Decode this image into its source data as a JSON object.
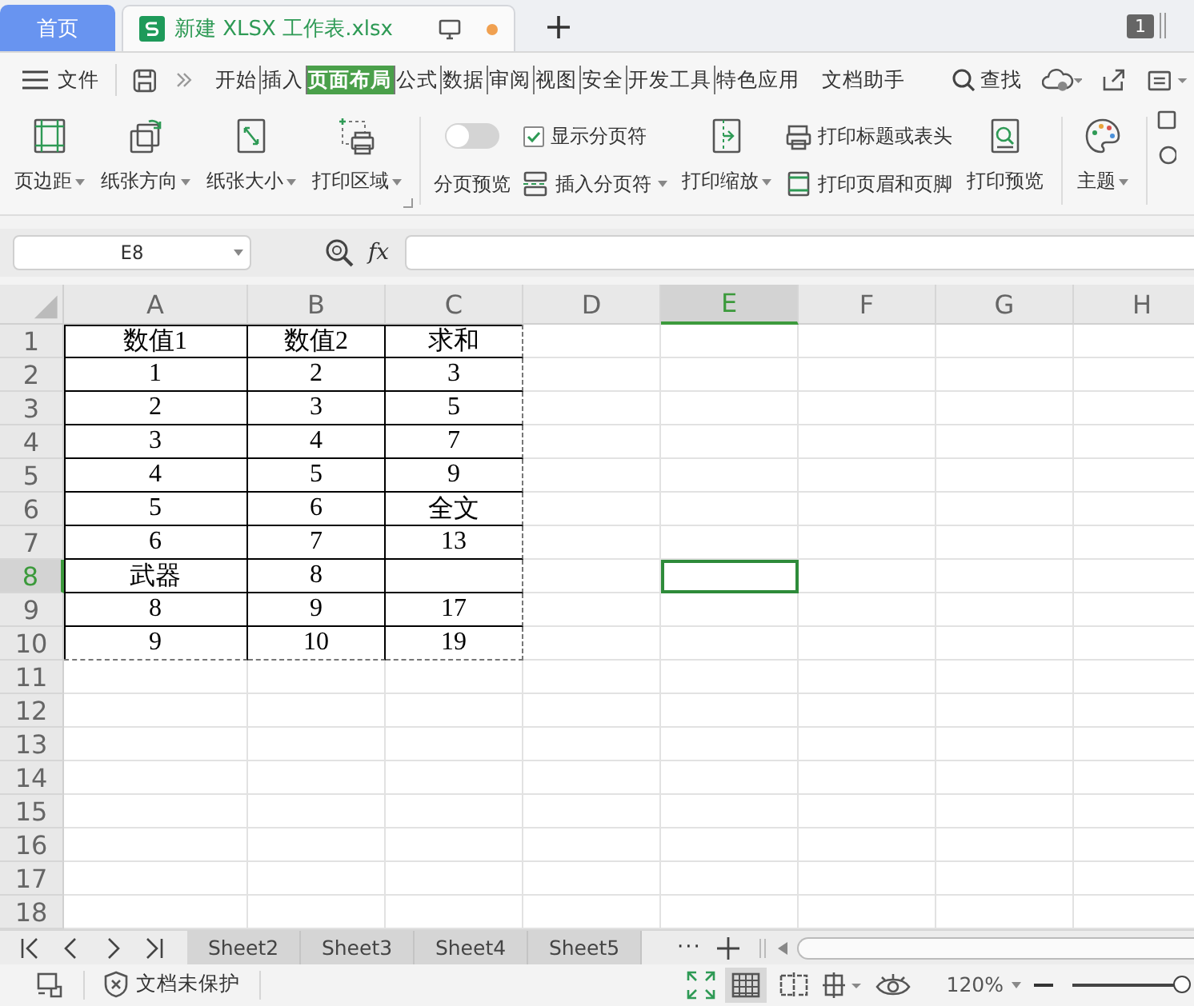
{
  "tab_bar": {
    "tabs": [
      {
        "kind": "home",
        "label": "首页",
        "selected": false
      },
      {
        "kind": "document",
        "label": "新建 XLSX 工作表.xlsx",
        "selected": true,
        "modified": true
      }
    ],
    "window_count": "1"
  },
  "menu_bar": {
    "file": "文件",
    "tabs": [
      {
        "label": "开始",
        "selected": false
      },
      {
        "label": "插入",
        "selected": false
      },
      {
        "label": "页面布局",
        "selected": true
      },
      {
        "label": "公式",
        "selected": false
      },
      {
        "label": "数据",
        "selected": false
      },
      {
        "label": "审阅",
        "selected": false
      },
      {
        "label": "视图",
        "selected": false
      },
      {
        "label": "安全",
        "selected": false
      },
      {
        "label": "开发工具",
        "selected": false
      },
      {
        "label": "特色应用",
        "selected": false
      },
      {
        "label": "文档助手",
        "selected": false
      }
    ],
    "search": "查找"
  },
  "ribbon": {
    "groups": [
      {
        "items": [
          {
            "kind": "large",
            "label": "页边距",
            "dropdown": true
          },
          {
            "kind": "large",
            "label": "纸张方向",
            "dropdown": true
          },
          {
            "kind": "large",
            "label": "纸张大小",
            "dropdown": true
          },
          {
            "kind": "large",
            "label": "打印区域",
            "dropdown": true
          }
        ]
      },
      {
        "items": [
          {
            "kind": "toggle",
            "label": "分页预览",
            "on": false
          },
          {
            "kind": "stack",
            "rows": [
              {
                "kind": "check",
                "label": "显示分页符",
                "checked": true
              },
              {
                "kind": "small",
                "label": "插入分页符",
                "dropdown": true
              }
            ]
          },
          {
            "kind": "large",
            "label": "打印缩放",
            "dropdown": true
          },
          {
            "kind": "stack",
            "rows": [
              {
                "kind": "small",
                "label": "打印标题或表头",
                "dropdown": false
              },
              {
                "kind": "small",
                "label": "打印页眉和页脚",
                "dropdown": false
              }
            ]
          },
          {
            "kind": "large",
            "label": "打印预览",
            "dropdown": false
          }
        ]
      },
      {
        "items": [
          {
            "kind": "large",
            "label": "主题",
            "dropdown": true
          }
        ]
      }
    ]
  },
  "formula_bar": {
    "name_box": "E8",
    "fx": "fx"
  },
  "sheet": {
    "columns": [
      {
        "label": "A",
        "selected": false
      },
      {
        "label": "B",
        "selected": false
      },
      {
        "label": "C",
        "selected": false
      },
      {
        "label": "D",
        "selected": false
      },
      {
        "label": "E",
        "selected": true
      },
      {
        "label": "F",
        "selected": false
      },
      {
        "label": "G",
        "selected": false
      },
      {
        "label": "H",
        "selected": false
      }
    ],
    "rows": [
      {
        "label": "1",
        "selected": false,
        "cells": [
          "数值1",
          "数值2",
          "求和"
        ]
      },
      {
        "label": "2",
        "selected": false,
        "cells": [
          "1",
          "2",
          "3"
        ]
      },
      {
        "label": "3",
        "selected": false,
        "cells": [
          "2",
          "3",
          "5"
        ]
      },
      {
        "label": "4",
        "selected": false,
        "cells": [
          "3",
          "4",
          "7"
        ]
      },
      {
        "label": "5",
        "selected": false,
        "cells": [
          "4",
          "5",
          "9"
        ]
      },
      {
        "label": "6",
        "selected": false,
        "cells": [
          "5",
          "6",
          "全文"
        ]
      },
      {
        "label": "7",
        "selected": false,
        "cells": [
          "6",
          "7",
          "13"
        ]
      },
      {
        "label": "8",
        "selected": true,
        "cells": [
          "武器",
          "8"
        ]
      },
      {
        "label": "9",
        "selected": false,
        "cells": [
          "8",
          "9",
          "17"
        ]
      },
      {
        "label": "10",
        "selected": false,
        "cells": [
          "9",
          "10",
          "19"
        ]
      },
      {
        "label": "11",
        "selected": false
      },
      {
        "label": "12",
        "selected": false
      },
      {
        "label": "13",
        "selected": false
      },
      {
        "label": "14",
        "selected": false
      },
      {
        "label": "15",
        "selected": false
      },
      {
        "label": "16",
        "selected": false
      },
      {
        "label": "17",
        "selected": false
      },
      {
        "label": "18",
        "selected": false
      }
    ]
  },
  "sheet_tabs": {
    "tabs": [
      {
        "label": "Sheet2",
        "selected": false
      },
      {
        "label": "Sheet3",
        "selected": false
      },
      {
        "label": "Sheet4",
        "selected": false
      },
      {
        "label": "Sheet5",
        "selected": false
      }
    ],
    "more": "···"
  },
  "status_bar": {
    "protection": "文档未保护",
    "zoom": "120%",
    "level": 0.95
  }
}
